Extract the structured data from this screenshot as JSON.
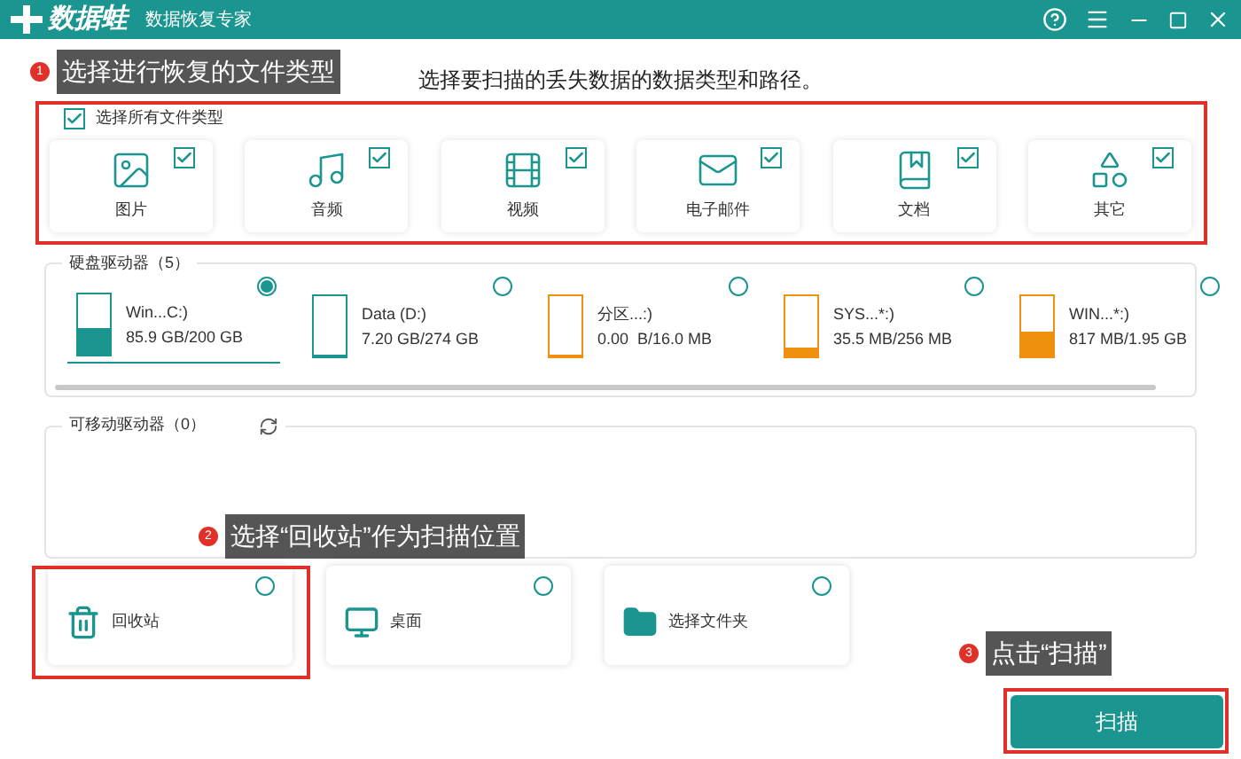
{
  "title_bar": {
    "logo": "数据蛙",
    "subtitle": "数据恢复专家"
  },
  "annotations": [
    {
      "number": "1",
      "text": "选择进行恢复的文件类型"
    },
    {
      "number": "2",
      "text": "选择“回收站”作为扫描位置"
    },
    {
      "number": "3",
      "text": "点击“扫描”"
    }
  ],
  "heading": "选择要扫描的丢失数据的数据类型和路径。",
  "file_types": {
    "select_all": {
      "label": "选择所有文件类型",
      "checked": true
    },
    "items": [
      {
        "kind": "image",
        "label": "图片",
        "checked": true
      },
      {
        "kind": "audio",
        "label": "音频",
        "checked": true
      },
      {
        "kind": "video",
        "label": "视频",
        "checked": true
      },
      {
        "kind": "email",
        "label": "电子邮件",
        "checked": true
      },
      {
        "kind": "document",
        "label": "文档",
        "checked": true
      },
      {
        "kind": "other",
        "label": "其它",
        "checked": true
      }
    ]
  },
  "hard_drives": {
    "title": "硬盘驱动器（5）",
    "items": [
      {
        "name": "Win...C:)",
        "usage": "85.9 GB/200 GB",
        "level": 0.43,
        "color": "#1a958f",
        "selected": true
      },
      {
        "name": "Data (D:)",
        "usage": "7.20 GB/274 GB",
        "level": 0.03,
        "color": "#1a958f",
        "selected": false
      },
      {
        "name": "分区...:)",
        "usage": "0.00  B/16.0 MB",
        "level": 0,
        "color": "#f0900f",
        "selected": false
      },
      {
        "name": "SYS...*:)",
        "usage": "35.5 MB/256 MB",
        "level": 0.14,
        "color": "#f0900f",
        "selected": false
      },
      {
        "name": "WIN...*:)",
        "usage": "817 MB/1.95 GB",
        "level": 0.42,
        "color": "#f0900f",
        "selected": false
      }
    ]
  },
  "removable_drives": {
    "title": "可移动驱动器（0）"
  },
  "locations": [
    {
      "kind": "recycle_bin",
      "label": "回收站",
      "selected": false
    },
    {
      "kind": "desktop",
      "label": "桌面",
      "selected": false
    },
    {
      "kind": "folder",
      "label": "选择文件夹",
      "selected": false
    }
  ],
  "scan_button": "扫描"
}
